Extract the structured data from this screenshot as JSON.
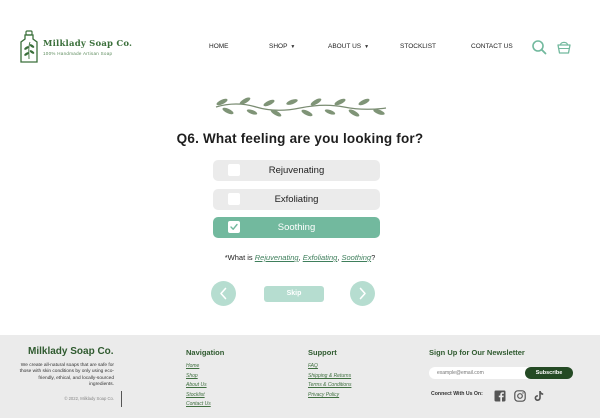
{
  "brand": {
    "name": "Milklady Soap Co.",
    "tagline": "100% Handmade Artisan Soap"
  },
  "nav": {
    "items": [
      {
        "label": "HOME",
        "has_dropdown": false
      },
      {
        "label": "SHOP",
        "has_dropdown": true
      },
      {
        "label": "ABOUT US",
        "has_dropdown": true
      },
      {
        "label": "STOCKLIST",
        "has_dropdown": false
      },
      {
        "label": "CONTACT US",
        "has_dropdown": false
      }
    ],
    "icons": [
      "search-icon",
      "basket-icon"
    ]
  },
  "quiz": {
    "question": "Q6. What feeling are you looking for?",
    "options": [
      {
        "label": "Rejuvenating",
        "selected": false
      },
      {
        "label": "Exfoliating",
        "selected": false
      },
      {
        "label": "Soothing",
        "selected": true
      }
    ],
    "whatis": {
      "prefix": "*What is ",
      "links": [
        "Rejuvenating",
        "Exfoliating",
        "Soothing"
      ],
      "sep": ", ",
      "suffix": "?"
    },
    "skip_label": "Skip"
  },
  "footer": {
    "brand": "Milklady Soap Co.",
    "description": "We create all-natural soaps that are safe for those with skin conditions by only using eco-friendly, ethical, and locally-sourced ingredients.",
    "copyright": "© 2022, Milklady Soap Co.",
    "navigation": {
      "heading": "Navigation",
      "links": [
        "Home",
        "Shop",
        "About Us",
        "Stocklist",
        "Contact Us"
      ]
    },
    "support": {
      "heading": "Support",
      "links": [
        "FAQ",
        "Shipping & Returns",
        "Terms & Conditions",
        "Privacy Policy"
      ]
    },
    "newsletter": {
      "heading": "Sign Up for Our Newsletter",
      "placeholder": "example@email.com",
      "button": "Subscribe",
      "connect_label": "Connect With Us On:"
    }
  },
  "colors": {
    "accent": "#72b99e",
    "accent_light": "#b6ddd0",
    "brand_green": "#3a6f3a",
    "dark_green": "#244a24"
  }
}
